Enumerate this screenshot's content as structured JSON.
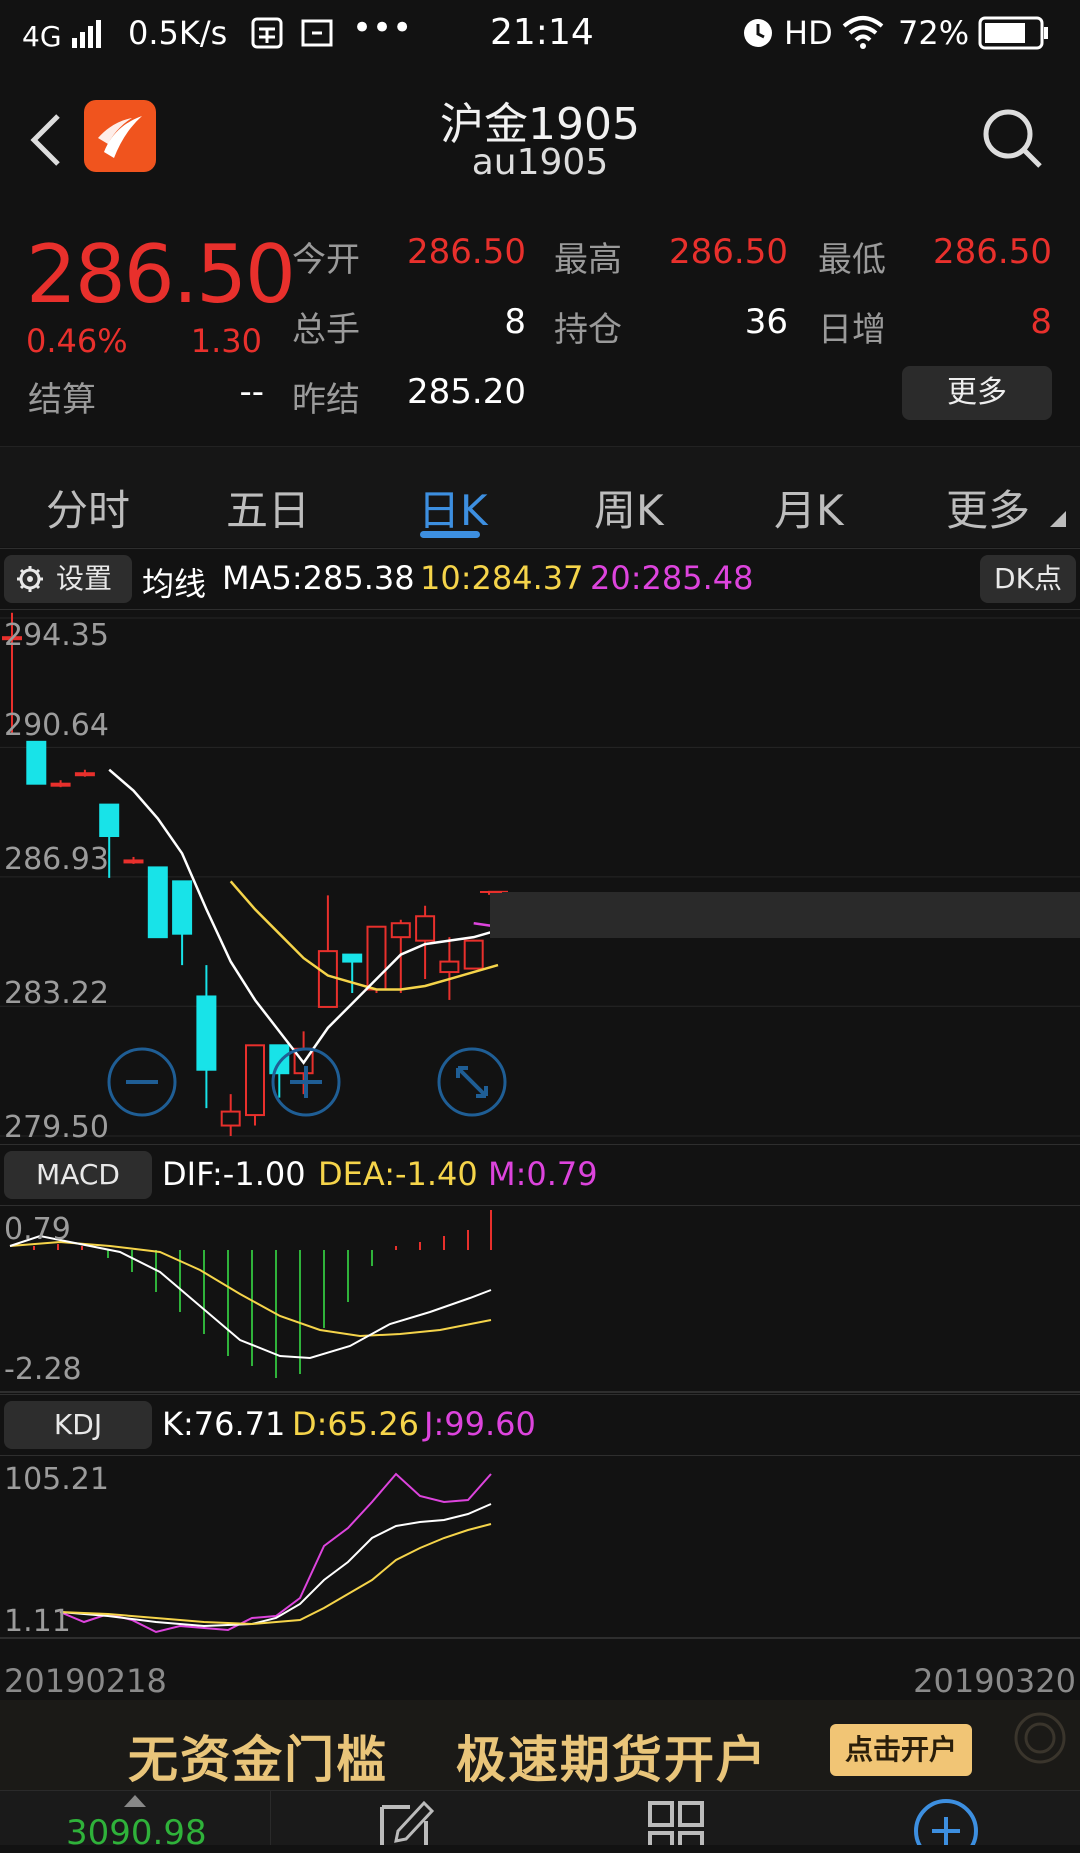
{
  "status_bar": {
    "network": "4G",
    "speed": "0.5K/s",
    "time": "21:14",
    "hd": "HD",
    "battery": "72%"
  },
  "header": {
    "title": "沪金1905",
    "code": "au1905"
  },
  "quote": {
    "price": "286.50",
    "change_pct": "0.46%",
    "change": "1.30",
    "settle_label": "结算",
    "settle_value": "--",
    "fields": [
      {
        "label": "今开",
        "value": "286.50"
      },
      {
        "label": "最高",
        "value": "286.50"
      },
      {
        "label": "最低",
        "value": "286.50"
      },
      {
        "label": "总手",
        "value": "8"
      },
      {
        "label": "持仓",
        "value": "36"
      },
      {
        "label": "日增",
        "value": "8"
      },
      {
        "label": "昨结",
        "value": "285.20"
      }
    ],
    "more_button": "更多"
  },
  "tabs": [
    "分时",
    "五日",
    "日K",
    "周K",
    "月K",
    "更多"
  ],
  "active_tab": 2,
  "ma_bar": {
    "settings": "设置",
    "label": "均线",
    "ma5": "MA5:285.38",
    "ma10": "10:284.37",
    "ma20": "20:285.48",
    "dk_button": "DK点"
  },
  "price_axis": [
    "294.35",
    "290.64",
    "286.93",
    "283.22",
    "279.50"
  ],
  "macd": {
    "label": "MACD",
    "dif": "DIF:-1.00",
    "dea": "DEA:-1.40",
    "m": "M:0.79",
    "axis": [
      "0.79",
      "-2.28"
    ]
  },
  "kdj": {
    "label": "KDJ",
    "k": "K:76.71",
    "d": "D:65.26",
    "j": "J:99.60",
    "axis": [
      "105.21",
      "1.11"
    ]
  },
  "dates": {
    "start": "20190218",
    "end": "20190320"
  },
  "banner": {
    "text1": "无资金门槛",
    "text2": "极速期货开户",
    "button": "点击开户"
  },
  "bottom_nav": {
    "index_value": "3090.98"
  },
  "colors": {
    "up": "#e8302c",
    "down": "#18e3e8",
    "ma10": "#f5d44a",
    "ma20": "#dd44dd",
    "accent": "#3d8fe0"
  },
  "chart_data": {
    "type": "candlestick",
    "ylim": [
      279.5,
      294.35
    ],
    "candles": [
      {
        "o": 293.8,
        "c": 293.8,
        "h": 294.5,
        "l": 291.0
      },
      {
        "o": 290.8,
        "c": 289.6,
        "h": 290.8,
        "l": 289.6
      },
      {
        "o": 289.6,
        "c": 289.6,
        "h": 289.7,
        "l": 289.5
      },
      {
        "o": 289.9,
        "c": 289.9,
        "h": 290.0,
        "l": 289.8
      },
      {
        "o": 289.0,
        "c": 288.1,
        "h": 289.0,
        "l": 286.9
      },
      {
        "o": 287.4,
        "c": 287.4,
        "h": 287.5,
        "l": 287.3
      },
      {
        "o": 287.2,
        "c": 285.2,
        "h": 287.2,
        "l": 285.2
      },
      {
        "o": 286.8,
        "c": 285.3,
        "h": 286.8,
        "l": 284.4
      },
      {
        "o": 283.5,
        "c": 281.4,
        "h": 284.4,
        "l": 280.3
      },
      {
        "o": 279.8,
        "c": 280.2,
        "h": 280.7,
        "l": 279.5
      },
      {
        "o": 280.1,
        "c": 282.1,
        "h": 282.1,
        "l": 279.8
      },
      {
        "o": 282.1,
        "c": 281.3,
        "h": 282.1,
        "l": 280.6
      },
      {
        "o": 281.3,
        "c": 282.0,
        "h": 282.5,
        "l": 280.7
      },
      {
        "o": 283.2,
        "c": 284.8,
        "h": 286.4,
        "l": 283.2
      },
      {
        "o": 284.7,
        "c": 284.5,
        "h": 284.7,
        "l": 283.6
      },
      {
        "o": 283.7,
        "c": 285.5,
        "h": 285.5,
        "l": 283.6
      },
      {
        "o": 285.2,
        "c": 285.6,
        "h": 285.7,
        "l": 283.6
      },
      {
        "o": 285.1,
        "c": 285.8,
        "h": 286.1,
        "l": 284.0
      },
      {
        "o": 284.2,
        "c": 284.5,
        "h": 285.2,
        "l": 283.4
      },
      {
        "o": 284.3,
        "c": 285.1,
        "h": 285.1,
        "l": 284.3
      },
      {
        "o": 286.5,
        "c": 286.5,
        "h": 286.5,
        "l": 286.5
      }
    ],
    "ma5": [
      null,
      null,
      null,
      null,
      290.0,
      289.4,
      288.6,
      287.6,
      286.0,
      284.5,
      283.4,
      282.5,
      281.6,
      282.6,
      283.3,
      284.0,
      284.7,
      285.0,
      285.1,
      285.2,
      285.4
    ],
    "ma10": [
      null,
      null,
      null,
      null,
      null,
      null,
      null,
      null,
      null,
      286.8,
      286.0,
      285.3,
      284.6,
      284.1,
      283.9,
      283.7,
      283.7,
      283.8,
      284.0,
      284.2,
      284.4
    ],
    "ma20": [
      null,
      null,
      null,
      null,
      null,
      null,
      null,
      null,
      null,
      null,
      null,
      null,
      null,
      null,
      null,
      null,
      null,
      null,
      null,
      285.6,
      285.5
    ]
  }
}
